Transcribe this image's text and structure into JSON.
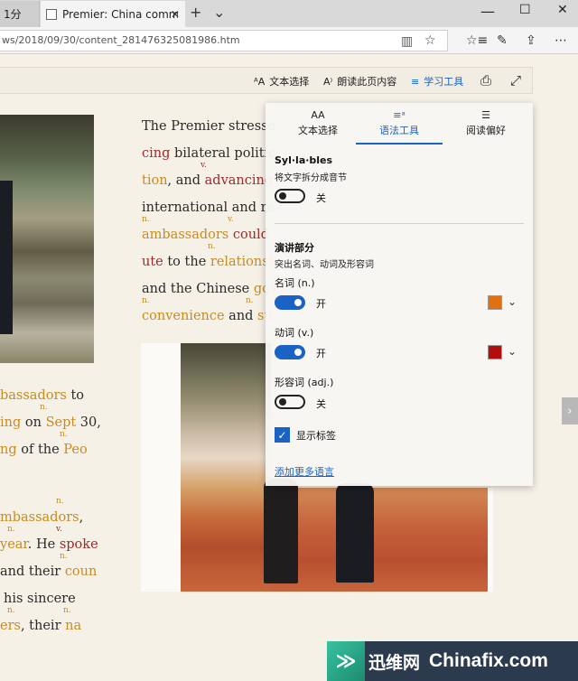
{
  "tabs": {
    "prev_label": "1分",
    "active_title": "Premier: China committ",
    "new_tab": "+",
    "tab_list": "⌄"
  },
  "window": {
    "minimize": "—",
    "maximize": "☐",
    "close": "✕"
  },
  "address": {
    "url": "ws/2018/09/30/content_281476325081986.htm",
    "reading_view_icon": "book-icon",
    "favorite_icon": "star-icon"
  },
  "toolbar_icons": [
    "favorites-icon",
    "pen-icon",
    "share-icon",
    "more-icon"
  ],
  "reading_toolbar": {
    "text_options": "文本选择",
    "read_aloud": "朗读此页内容",
    "learning_tools": "学习工具"
  },
  "article": {
    "left_lines": [
      {
        "pre": "",
        "hl": "bassadors",
        "post": " to",
        "cls": "noun"
      },
      {
        "pre": "",
        "hl": "ing",
        "post": " on ",
        "cls": "noun",
        "hl2": "Sept",
        "post2": " 30,"
      },
      {
        "pre": "",
        "hl": "ng",
        "post": " of the ",
        "cls": "noun",
        "hl2": "Peo",
        "post2": ""
      },
      {
        "pre": "",
        "hl": "mbassadors",
        "post": ",",
        "cls": "noun"
      },
      {
        "pre": "",
        "hl": "year",
        "post": ". He ",
        "cls": "noun",
        "hl2": "spoke",
        "cls2": "verb",
        "post2": ""
      },
      {
        "pre": "and their ",
        "hl": "coun",
        "post": "",
        "cls": "noun"
      },
      {
        "pre": "his sincere",
        "hl": "",
        "post": "",
        "cls": "noun"
      },
      {
        "pre": "",
        "hl": "ers",
        "post": ", their ",
        "cls": "noun",
        "hl2": "na",
        "post2": ""
      }
    ],
    "right_lines": [
      {
        "pre": "The Premier stresse",
        "hl": "",
        "post": ""
      },
      {
        "pre": "",
        "hl": "cing",
        "cls": "verb",
        "post": " bilateral politic"
      },
      {
        "pre": "",
        "hl": "tion",
        "cls": "noun",
        "post": ", and ",
        "hl2": "advancing",
        "cls2": "verb"
      },
      {
        "pre": "international and re",
        "hl": "",
        "post": ""
      },
      {
        "pre": "",
        "hl": "ambassadors",
        "cls": "noun",
        "post": " ",
        "hl2": "could",
        "cls2": "verb"
      },
      {
        "pre": "",
        "hl": "ute",
        "cls": "verb",
        "post": " to the ",
        "hl2": "relationsh",
        "cls2": "noun"
      },
      {
        "pre": "and the Chinese ",
        "hl": "gov",
        "cls": "noun",
        "post": ""
      },
      {
        "pre": "",
        "hl": "convenience",
        "cls": "noun",
        "post": " and ",
        "hl2": "su",
        "cls2": "noun"
      }
    ],
    "tag_noun": "n.",
    "tag_verb": "v."
  },
  "panel": {
    "tabs": [
      {
        "icon": "AA",
        "label": "文本选择"
      },
      {
        "icon": "≡ᵃ",
        "label": "语法工具"
      },
      {
        "icon": "☰",
        "label": "阅读偏好"
      }
    ],
    "syllables_title": "Syl·la·bles",
    "syllables_desc": "将文字拆分成音节",
    "syllables_state": "关",
    "pos_title": "演讲部分",
    "pos_desc": "突出名词、动词及形容词",
    "noun_label": "名词 (n.)",
    "noun_state": "开",
    "noun_color": "#e07010",
    "verb_label": "动词 (v.)",
    "verb_state": "开",
    "verb_color": "#b20e0e",
    "adj_label": "形容词 (adj.)",
    "adj_state": "关",
    "show_labels": "显示标签",
    "more_languages": "添加更多语言",
    "accent": "#1a62c4"
  },
  "side_arrow": "›",
  "watermark": {
    "logo": "≫",
    "cn": "迅维网",
    "en": "Chinafix.com"
  }
}
